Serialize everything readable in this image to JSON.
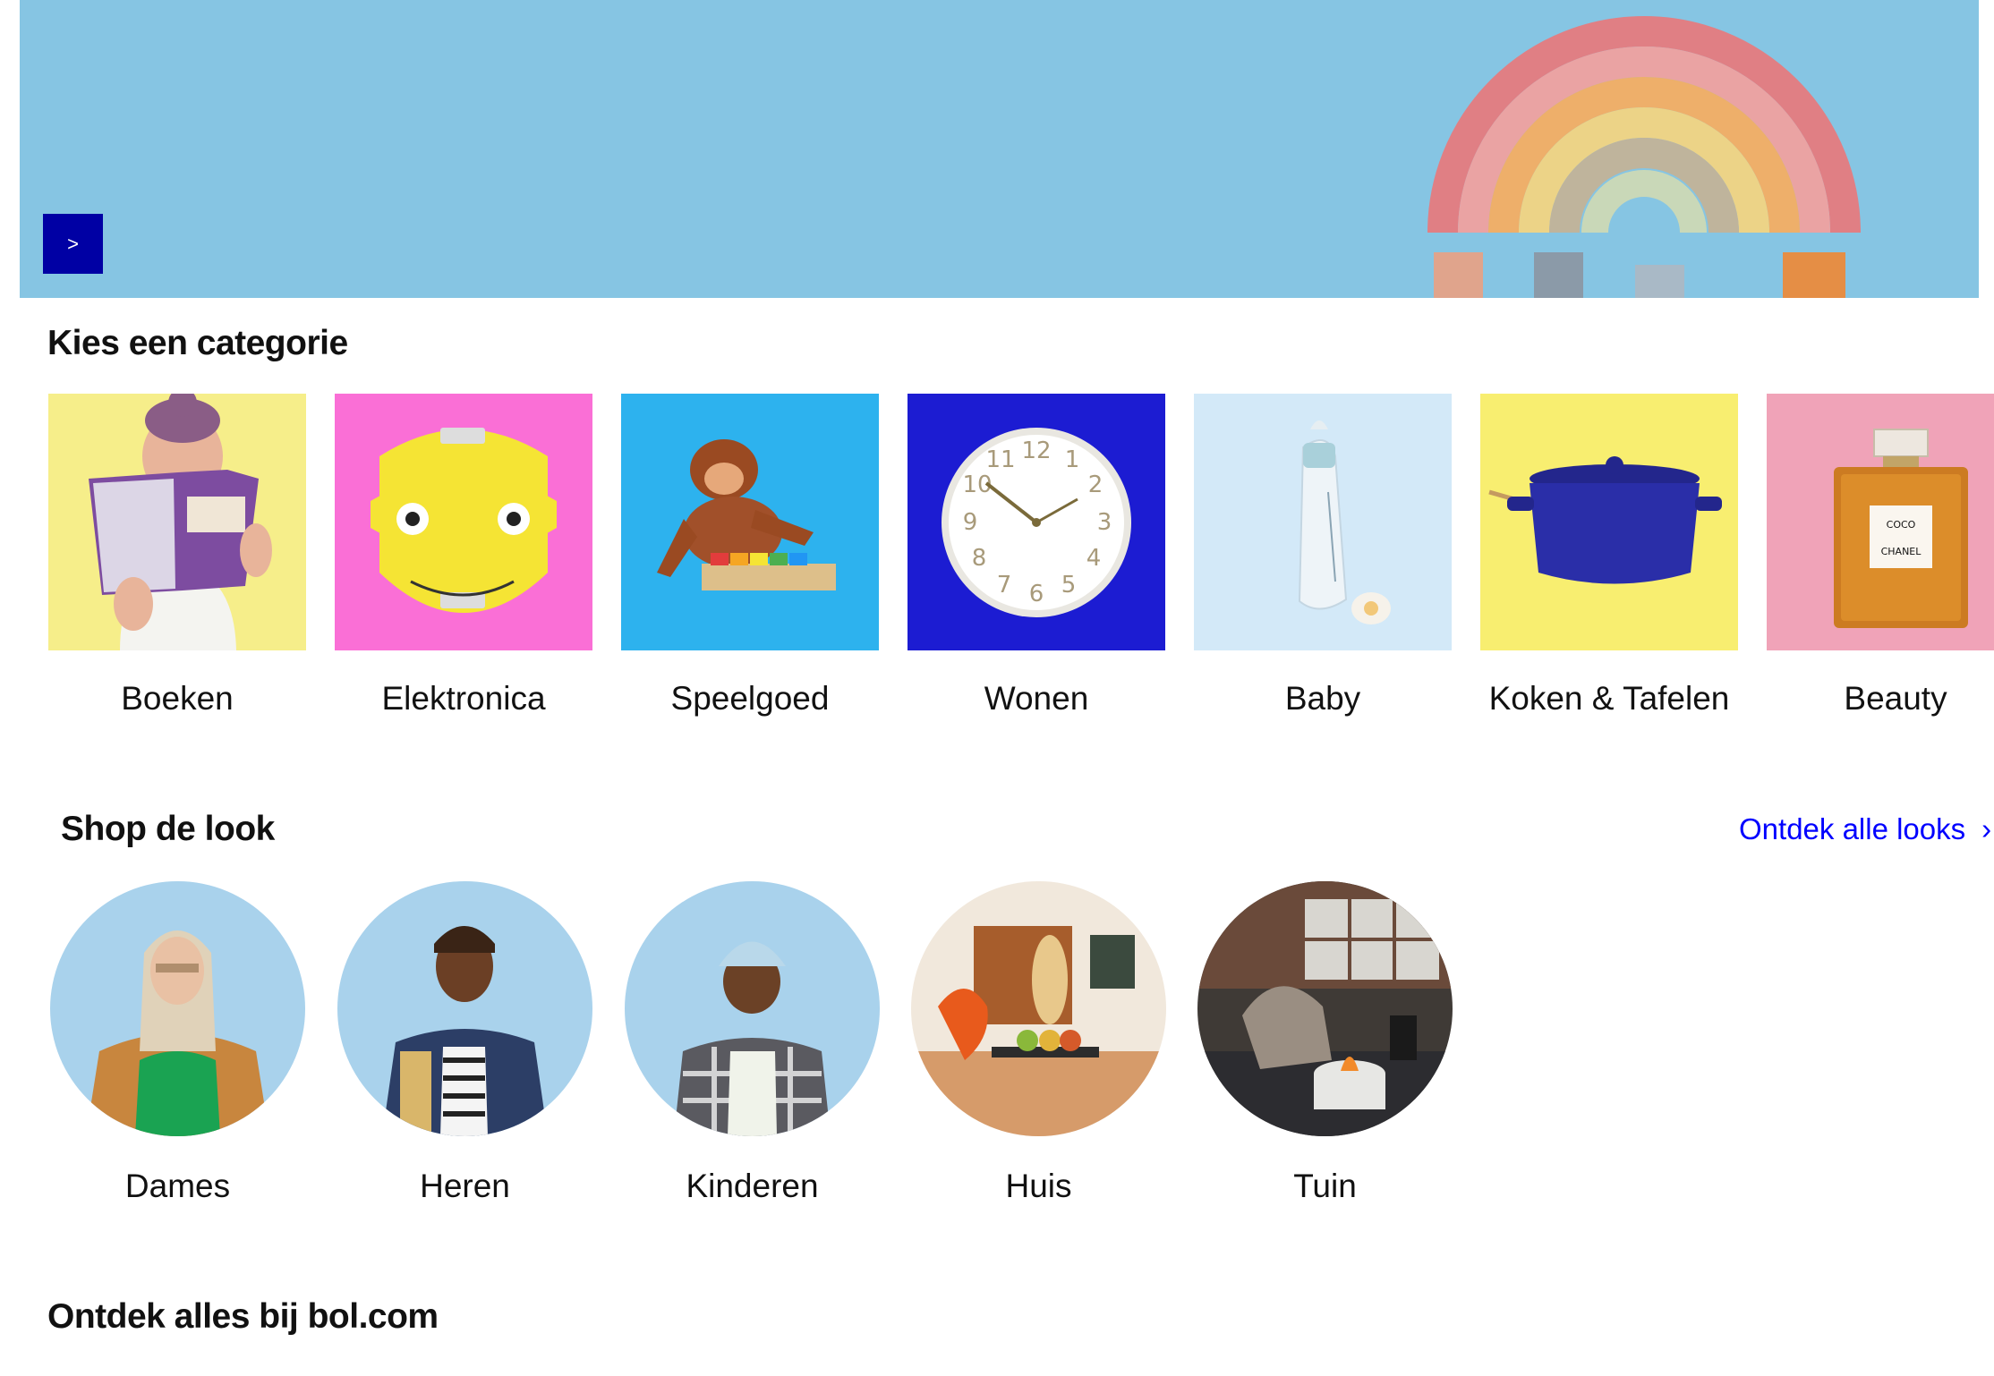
{
  "hero": {
    "next_label": ">",
    "background_color": "#86c5e3",
    "button_color": "#0000a4"
  },
  "categories": {
    "title": "Kies een categorie",
    "items": [
      {
        "label": "Boeken",
        "bg": "#f6ee8a"
      },
      {
        "label": "Elektronica",
        "bg": "#fa6fd6"
      },
      {
        "label": "Speelgoed",
        "bg": "#2db2ee"
      },
      {
        "label": "Wonen",
        "bg": "#1c1cd2"
      },
      {
        "label": "Baby",
        "bg": "#d3e9f8"
      },
      {
        "label": "Koken & Tafelen",
        "bg": "#f8ee70"
      },
      {
        "label": "Beauty",
        "bg": "#f0a3b8"
      }
    ]
  },
  "looks": {
    "title": "Shop de look",
    "link_label": "Ontdek alle looks",
    "link_chevron": "›",
    "items": [
      {
        "label": "Dames"
      },
      {
        "label": "Heren"
      },
      {
        "label": "Kinderen"
      },
      {
        "label": "Huis"
      },
      {
        "label": "Tuin"
      }
    ]
  },
  "discover": {
    "title": "Ontdek alles bij bol.com"
  },
  "colors": {
    "link": "#0000ff",
    "text": "#111111"
  }
}
